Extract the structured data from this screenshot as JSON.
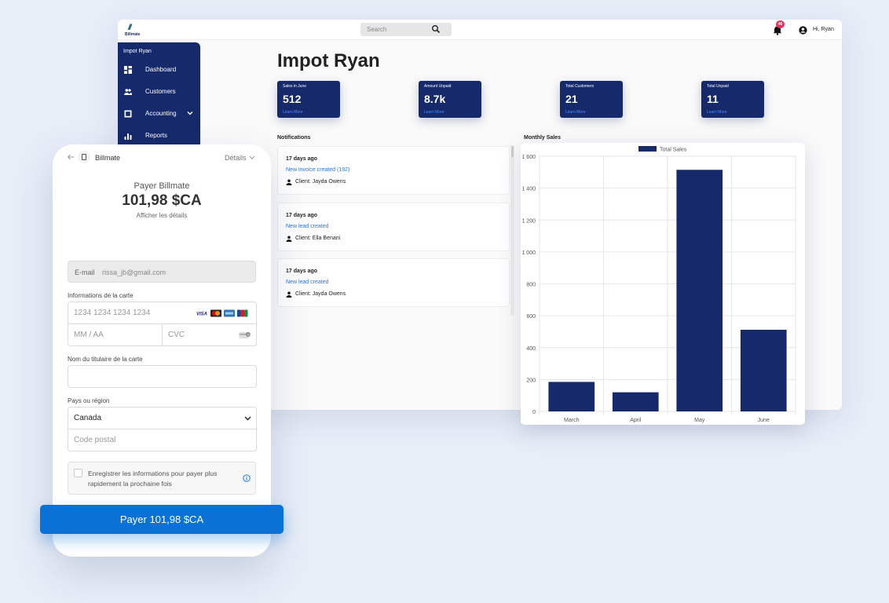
{
  "dashboard": {
    "logo_text": "Billmate",
    "search_placeholder": "Search",
    "notification_count": "46",
    "greeting": "Hi, Ryan",
    "sidebar": {
      "title": "Impot Ryan",
      "items": [
        {
          "label": "Dashboard",
          "icon": "dashboard-icon"
        },
        {
          "label": "Customers",
          "icon": "people-icon"
        },
        {
          "label": "Accounting",
          "icon": "ledger-icon"
        },
        {
          "label": "Reports",
          "icon": "bar-chart-icon"
        }
      ]
    },
    "page_title": "Impot Ryan",
    "cards": [
      {
        "label": "Sales in June",
        "value": "512",
        "link": "Learn More"
      },
      {
        "label": "Amount Unpaid",
        "value": "8.7k",
        "link": "Learn More"
      },
      {
        "label": "Total Customers",
        "value": "21",
        "link": "Learn More"
      },
      {
        "label": "Total Unpaid",
        "value": "11",
        "link": "Learn More"
      }
    ],
    "notifications_label": "Notifications",
    "notifications": [
      {
        "time": "17 days ago",
        "title": "New invoice created (192)",
        "client": "Client: Jayda Owens"
      },
      {
        "time": "17 days ago",
        "title": "New lead created",
        "client": "Client: Ella Benani"
      },
      {
        "time": "17 days ago",
        "title": "New lead created",
        "client": "Client: Jayda Owens"
      }
    ],
    "monthly_sales_label": "Monthly Sales",
    "colors": {
      "navy": "#15296b",
      "link": "#2f74e0",
      "badge": "#e8325a"
    }
  },
  "chart_data": {
    "type": "bar",
    "categories": [
      "March",
      "April",
      "May",
      "June"
    ],
    "series": [
      {
        "name": "Total Sales",
        "values": [
          185,
          120,
          1515,
          512
        ]
      }
    ],
    "ylim": [
      0,
      1600
    ],
    "yticks": [
      "0",
      "200",
      "400",
      "600",
      "800",
      "1 000",
      "1 200",
      "1 400",
      "1 600"
    ],
    "grid": true,
    "legend": "top",
    "bar_color": "#15296b"
  },
  "payment": {
    "merchant": "Billmate",
    "details_label": "Détails",
    "pay_to": "Payer Billmate",
    "amount": "101,98 $CA",
    "show_details": "Afficher les détails",
    "email_label": "E-mail",
    "email_value": "rissa_jb@gmail.com",
    "card_info_label": "Informations de la carte",
    "card_number_placeholder": "1234 1234 1234 1234",
    "expiry_placeholder": "MM / AA",
    "cvc_placeholder": "CVC",
    "holder_label": "Nom du titulaire de la carte",
    "holder_value": "",
    "country_label": "Pays ou région",
    "country_value": "Canada",
    "postal_placeholder": "Code postal",
    "save_text": "Enregistrer les informations pour payer plus rapidement la prochaine fois",
    "pay_button": "Payer 101,98 $CA",
    "card_brands": [
      "visa",
      "mastercard",
      "amex",
      "jcb"
    ]
  }
}
